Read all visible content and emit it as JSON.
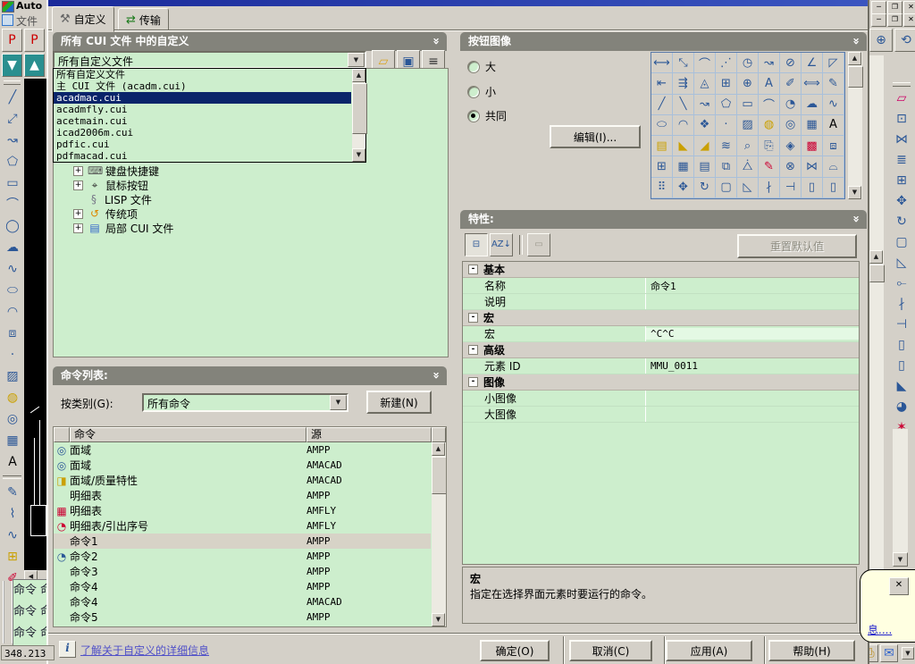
{
  "colors": {
    "selection": "#0a246a",
    "panel_green": "#cdeecd",
    "header_gray": "#83837b",
    "link": "#5050c8",
    "balloon_bg": "#ffffe1",
    "title_strip": "#1a2a9a"
  },
  "window": {
    "app_title": "Auto",
    "menu_file": "文件",
    "coords": "348.213",
    "toolbar_row1": [
      {
        "name": "pdf-export-icon",
        "glyph": "P",
        "color": "#c00"
      },
      {
        "name": "pdf-import-icon",
        "glyph": "P",
        "color": "#c00"
      }
    ],
    "toolbar_row2": [
      {
        "name": "publish-icon",
        "glyph": "▼",
        "color": "#fff",
        "bg": "#2a8f8f"
      },
      {
        "name": "etransmit-icon",
        "glyph": "▲",
        "color": "#fff",
        "bg": "#2a8f8f"
      }
    ],
    "left_toolbar_group1": [
      {
        "name": "line-icon",
        "glyph": "╱"
      },
      {
        "name": "construction-line-icon",
        "glyph": "⤢"
      },
      {
        "name": "polyline-icon",
        "glyph": "↝"
      },
      {
        "name": "polygon-icon",
        "glyph": "⬠"
      },
      {
        "name": "rectangle-icon",
        "glyph": "▭"
      },
      {
        "name": "arc-icon",
        "glyph": "⌒"
      },
      {
        "name": "circle-icon",
        "glyph": "◯"
      },
      {
        "name": "revcloud-icon",
        "glyph": "☁"
      },
      {
        "name": "spline-icon",
        "glyph": "∿"
      },
      {
        "name": "ellipse-icon",
        "glyph": "⬭"
      },
      {
        "name": "ellipse-arc-icon",
        "glyph": "◠"
      },
      {
        "name": "insert-block-icon",
        "glyph": "⧈"
      },
      {
        "name": "point-icon",
        "glyph": "·"
      },
      {
        "name": "hatch-icon",
        "glyph": "▨"
      },
      {
        "name": "gradient-icon",
        "glyph": "◍",
        "color": "#caa002"
      },
      {
        "name": "region-icon",
        "glyph": "◎"
      },
      {
        "name": "table-icon",
        "glyph": "▦"
      },
      {
        "name": "mtext-icon",
        "glyph": "A",
        "color": "#000"
      }
    ],
    "left_toolbar_group2": [
      {
        "name": "edit-hatch-icon",
        "glyph": "✎"
      },
      {
        "name": "edit-polyline-icon",
        "glyph": "⌇"
      },
      {
        "name": "edit-spline-icon",
        "glyph": "∿"
      },
      {
        "name": "edit-array-icon",
        "glyph": "⊞",
        "color": "#caa002"
      },
      {
        "name": "edit-attribute-icon",
        "glyph": "✐",
        "color": "#c03"
      }
    ],
    "right_toolbar": [
      {
        "name": "erase-icon",
        "glyph": "▱",
        "color": "#c06"
      },
      {
        "name": "copy-icon",
        "glyph": "⊡"
      },
      {
        "name": "mirror-icon",
        "glyph": "⋈"
      },
      {
        "name": "offset-icon",
        "glyph": "≣"
      },
      {
        "name": "array-icon",
        "glyph": "⊞"
      },
      {
        "name": "move-icon",
        "glyph": "✥"
      },
      {
        "name": "rotate-icon",
        "glyph": "↻"
      },
      {
        "name": "scale-icon",
        "glyph": "▢"
      },
      {
        "name": "stretch-icon",
        "glyph": "◺"
      },
      {
        "name": "lengthen-icon",
        "glyph": "⟜"
      },
      {
        "name": "trim-icon",
        "glyph": "∤"
      },
      {
        "name": "extend-icon",
        "glyph": "⊣"
      },
      {
        "name": "break-at-point-icon",
        "glyph": "▯"
      },
      {
        "name": "break-icon",
        "glyph": "▯"
      },
      {
        "name": "chamfer-icon",
        "glyph": "◣"
      },
      {
        "name": "fillet-icon",
        "glyph": "◕"
      },
      {
        "name": "explode-icon",
        "glyph": "✶",
        "color": "#c03"
      }
    ],
    "zoom_toolbar": [
      {
        "name": "zoom-realtime-icon",
        "glyph": "⊕"
      },
      {
        "name": "zoom-previous-icon",
        "glyph": "⟲"
      }
    ],
    "window_buttons_app": [
      {
        "name": "app-minimize-button",
        "glyph": "─"
      },
      {
        "name": "app-restore-button",
        "glyph": "❐"
      },
      {
        "name": "app-close-button",
        "glyph": "✕"
      }
    ],
    "window_buttons_doc": [
      {
        "name": "doc-minimize-button",
        "glyph": "─"
      },
      {
        "name": "doc-restore-button",
        "glyph": "❐"
      },
      {
        "name": "doc-close-button",
        "glyph": "✕"
      }
    ],
    "tray_icons": [
      {
        "name": "plotter-tray-icon",
        "glyph": "⎙",
        "color": "#b8860b"
      },
      {
        "name": "communication-center-icon",
        "glyph": "✉",
        "color": "#36c"
      }
    ],
    "palette_rows": [
      "命令",
      "命令",
      "命令"
    ]
  },
  "balloon": {
    "link_text": "息...."
  },
  "dialog": {
    "tabs": [
      {
        "name": "tab-customize",
        "label": "自定义",
        "glyph": "⚒",
        "active": true
      },
      {
        "name": "tab-transfer",
        "label": "传输",
        "glyph": "⇄",
        "active": false
      }
    ],
    "panels": {
      "cui_files": {
        "title": "所有 CUI 文件 中的自定义",
        "combo_value": "所有自定义文件",
        "toolbar_icons": [
          {
            "name": "load-cui-file-icon",
            "glyph": "▱",
            "color": "#d9a520"
          },
          {
            "name": "save-cui-file-icon",
            "glyph": "▣",
            "color": "#2b5797"
          },
          {
            "name": "expand-list-icon",
            "glyph": "≡",
            "color": "#333"
          }
        ],
        "dropdown_items": [
          {
            "label": "所有自定义文件",
            "selected": false
          },
          {
            "label": "主 CUI 文件 (acadm.cui)",
            "selected": false
          },
          {
            "label": "acadmac.cui",
            "selected": true
          },
          {
            "label": "acadmfly.cui",
            "selected": false
          },
          {
            "label": "acetmain.cui",
            "selected": false
          },
          {
            "label": "icad2006m.cui",
            "selected": false
          },
          {
            "label": "pdfic.cui",
            "selected": false
          },
          {
            "label": "pdfmacad.cui",
            "selected": false
          }
        ],
        "tree_items": [
          {
            "label": "键盘快捷键",
            "icon": "keyboard-icon",
            "glyph": "⌨",
            "color": "#555",
            "expand": true
          },
          {
            "label": "鼠标按钮",
            "icon": "mouse-icon",
            "glyph": "⌖",
            "color": "#333",
            "expand": true
          },
          {
            "label": "LISP 文件",
            "icon": "lisp-file-icon",
            "glyph": "§",
            "color": "#778",
            "expand": false
          },
          {
            "label": "传统项",
            "icon": "legacy-items-icon",
            "glyph": "↺",
            "color": "#d80",
            "expand": true
          },
          {
            "label": "局部 CUI 文件",
            "icon": "partial-cui-file-icon",
            "glyph": "▤",
            "color": "#36c",
            "expand": true
          }
        ]
      },
      "command_list": {
        "title": "命令列表:",
        "category_label": "按类别(G):",
        "category_value": "所有命令",
        "new_button": "新建(N)",
        "columns": [
          "命令",
          "源"
        ],
        "rows": [
          {
            "name": "面域",
            "source": "AMPP",
            "icon": "region-icon",
            "glyph": "◎",
            "color": "#2b5797",
            "selected": false
          },
          {
            "name": "面域",
            "source": "AMACAD",
            "icon": "region-icon",
            "glyph": "◎",
            "color": "#2b5797",
            "selected": false
          },
          {
            "name": "面域/质量特性",
            "source": "AMACAD",
            "icon": "mass-properties-icon",
            "glyph": "◨",
            "color": "#caa002",
            "selected": false
          },
          {
            "name": "明细表",
            "source": "AMPP",
            "icon": "",
            "glyph": "",
            "color": "",
            "selected": false
          },
          {
            "name": "明细表",
            "source": "AMFLY",
            "icon": "bom-table-icon",
            "glyph": "▦",
            "color": "#c03",
            "selected": false
          },
          {
            "name": "明细表/引出序号",
            "source": "AMFLY",
            "icon": "balloon-bom-icon",
            "glyph": "◔",
            "color": "#c03",
            "selected": false
          },
          {
            "name": "命令1",
            "source": "AMPP",
            "icon": "",
            "glyph": "",
            "color": "",
            "selected": true
          },
          {
            "name": "命令2",
            "source": "AMPP",
            "icon": "clock-icon",
            "glyph": "◔",
            "color": "#2b5797",
            "selected": false
          },
          {
            "name": "命令3",
            "source": "AMPP",
            "icon": "",
            "glyph": "",
            "color": "",
            "selected": false
          },
          {
            "name": "命令4",
            "source": "AMPP",
            "icon": "",
            "glyph": "",
            "color": "",
            "selected": false
          },
          {
            "name": "命令4",
            "source": "AMACAD",
            "icon": "",
            "glyph": "",
            "color": "",
            "selected": false
          },
          {
            "name": "命令5",
            "source": "AMPP",
            "icon": "",
            "glyph": "",
            "color": "",
            "selected": false
          }
        ]
      },
      "button_image": {
        "title": "按钮图像",
        "radios": [
          {
            "name": "radio-large",
            "label": "大",
            "checked": false
          },
          {
            "name": "radio-small",
            "label": "小",
            "checked": false
          },
          {
            "name": "radio-both",
            "label": "共同",
            "checked": true
          }
        ],
        "edit_button": "编辑(I)...",
        "grid_glyphs": [
          "⟷",
          "⤡",
          "⌒",
          "⋰",
          "◷",
          "↝",
          "⊘",
          "∠",
          "◸",
          "⇤",
          "⇶",
          "◬",
          "⊞",
          "⊕",
          "A",
          "✐",
          "⟺",
          "✎",
          "╱",
          "╲",
          "↝",
          "⬠",
          "▭",
          "⌒",
          "◔",
          "☁",
          "∿",
          "⬭",
          "◠",
          "❖",
          "·",
          "▨",
          "#caa002|◍",
          "◎",
          "▦",
          "#000|A",
          "#caa002|▤",
          "#caa002|◣",
          "#caa002|◢",
          "≋",
          "⌕",
          "⎘",
          "◈",
          "#c03|▩",
          "⧈",
          "⊞",
          "▦",
          "▤",
          "⧉",
          "⧊",
          "#c03|✎",
          "⊗",
          "⋈",
          "⌓",
          "⠿",
          "✥",
          "↻",
          "▢",
          "◺",
          "∤",
          "⊣",
          "▯",
          "▯"
        ]
      },
      "properties": {
        "title": "特性:",
        "toolbar": [
          {
            "name": "categorized-view-icon",
            "glyph": "⊟",
            "pressed": true
          },
          {
            "name": "alphabetical-sort-icon",
            "glyph": "AZ↓",
            "pressed": false
          },
          {
            "name": "property-pages-icon",
            "glyph": "▭",
            "disabled": true
          }
        ],
        "reset_button": "重置默认值",
        "rows": [
          {
            "type": "category",
            "label": "基本"
          },
          {
            "type": "prop",
            "label": "名称",
            "value": "命令1",
            "selected": false
          },
          {
            "type": "prop",
            "label": "说明",
            "value": "",
            "selected": false
          },
          {
            "type": "category",
            "label": "宏"
          },
          {
            "type": "prop",
            "label": "宏",
            "value": "^C^C",
            "selected": true
          },
          {
            "type": "category",
            "label": "高级"
          },
          {
            "type": "prop",
            "label": "元素 ID",
            "value": "MMU_0011",
            "selected": false
          },
          {
            "type": "category",
            "label": "图像"
          },
          {
            "type": "prop",
            "label": "小图像",
            "value": "",
            "selected": false
          },
          {
            "type": "prop",
            "label": "大图像",
            "value": "",
            "selected": false
          }
        ],
        "description_title": "宏",
        "description_text": "指定在选择界面元素时要运行的命令。"
      }
    },
    "footer": {
      "learn_link": "了解关于自定义的详细信息",
      "buttons": [
        {
          "name": "ok-button",
          "label": "确定(O)"
        },
        {
          "name": "cancel-button",
          "label": "取消(C)"
        },
        {
          "name": "apply-button",
          "label": "应用(A)"
        },
        {
          "name": "help-button",
          "label": "帮助(H)"
        }
      ]
    }
  }
}
